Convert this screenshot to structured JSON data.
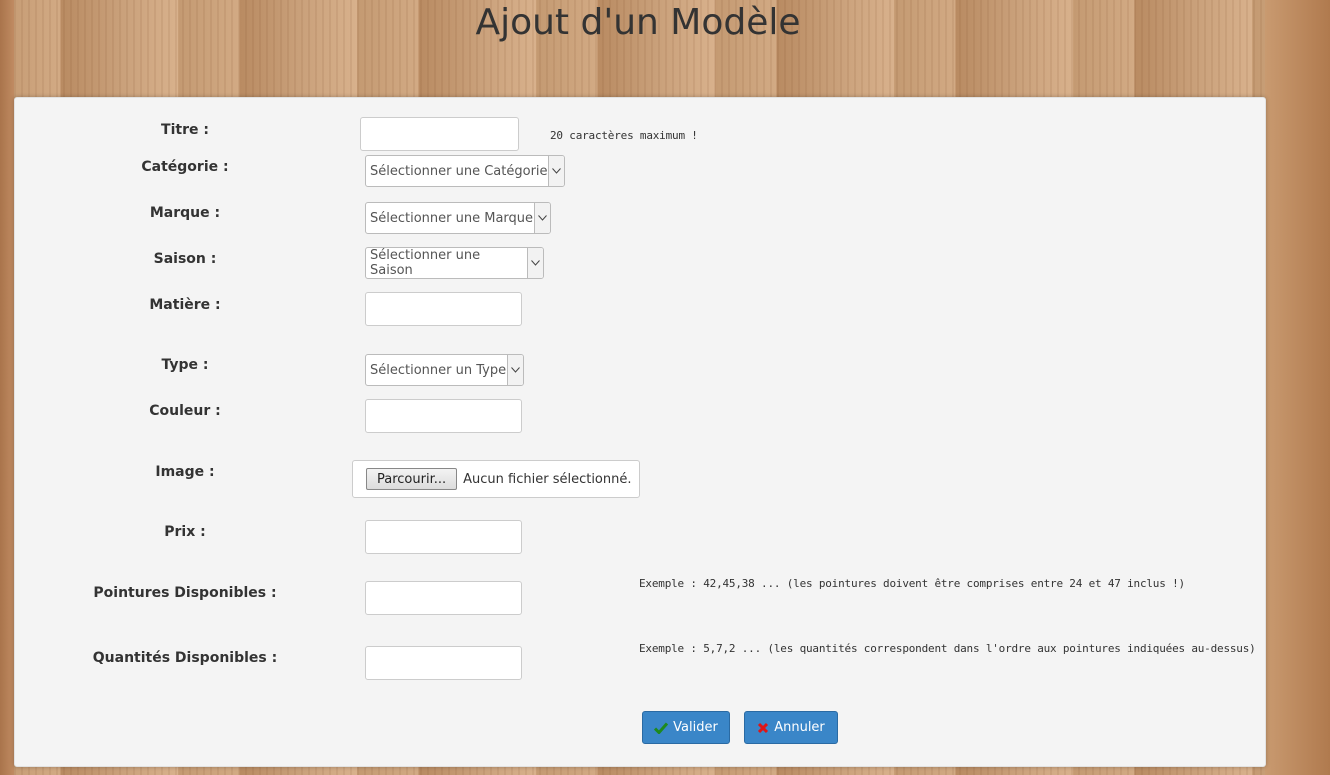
{
  "page": {
    "title": "Ajout d'un Modèle"
  },
  "form": {
    "titre": {
      "label": "Titre :",
      "value": "",
      "hint": "20 caractères maximum !"
    },
    "categorie": {
      "label": "Catégorie :",
      "selected": "Sélectionner une Catégorie"
    },
    "marque": {
      "label": "Marque :",
      "selected": "Sélectionner une Marque"
    },
    "saison": {
      "label": "Saison :",
      "selected": "Sélectionner une Saison"
    },
    "matiere": {
      "label": "Matière :",
      "value": ""
    },
    "type": {
      "label": "Type :",
      "selected": "Sélectionner un Type"
    },
    "couleur": {
      "label": "Couleur :",
      "value": ""
    },
    "image": {
      "label": "Image :",
      "browse_label": "Parcourir...",
      "status": "Aucun fichier sélectionné."
    },
    "prix": {
      "label": "Prix :",
      "value": ""
    },
    "pointures": {
      "label": "Pointures Disponibles :",
      "value": "",
      "hint": "Exemple : 42,45,38 ... (les pointures doivent être comprises entre 24 et 47 inclus !)"
    },
    "quantites": {
      "label": "Quantités Disponibles :",
      "value": "",
      "hint": "Exemple : 5,7,2 ... (les quantités correspondent dans l'ordre aux pointures indiquées au-dessus)"
    }
  },
  "buttons": {
    "valider": {
      "label": "Valider",
      "icon": "check-icon",
      "icon_color": "#1e8a1e"
    },
    "annuler": {
      "label": "Annuler",
      "icon": "x-icon",
      "icon_color": "#e01515"
    }
  },
  "colors": {
    "button_bg": "#3a86c8",
    "panel_bg": "#f4f4f4"
  }
}
